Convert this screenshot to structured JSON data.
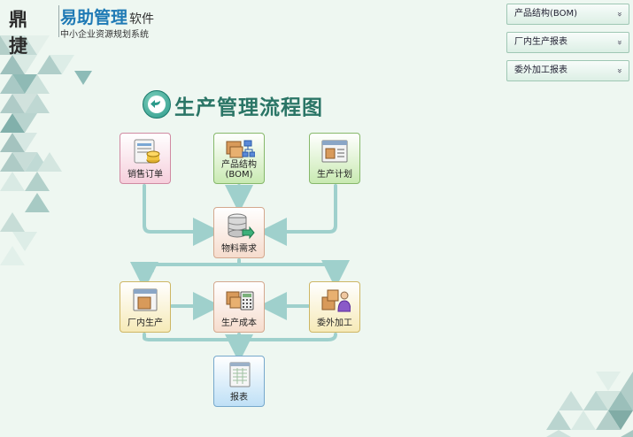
{
  "brand": {
    "mark": "鼎捷",
    "name": "易助管理",
    "suffix": "软件",
    "subtitle": "中小企业资源规划系统"
  },
  "side_buttons": [
    {
      "label": "产品结构(BOM)",
      "chevron": "»"
    },
    {
      "label": "厂内生产报表",
      "chevron": "»"
    },
    {
      "label": "委外加工报表",
      "chevron": "»"
    }
  ],
  "page_title": "生产管理流程图",
  "nodes": {
    "sales_order": {
      "label": "销售订单"
    },
    "bom": {
      "label_line1": "产品结构",
      "label_line2": "(BOM)"
    },
    "plan": {
      "label": "生产计划"
    },
    "material": {
      "label": "物料需求"
    },
    "inhouse": {
      "label": "厂内生产"
    },
    "cost": {
      "label": "生产成本"
    },
    "outsource": {
      "label": "委外加工"
    },
    "report": {
      "label": "报表"
    }
  },
  "colors": {
    "arrow": "#9fd0cc",
    "title": "#2a7566",
    "brand_blue": "#1f7ab5"
  }
}
